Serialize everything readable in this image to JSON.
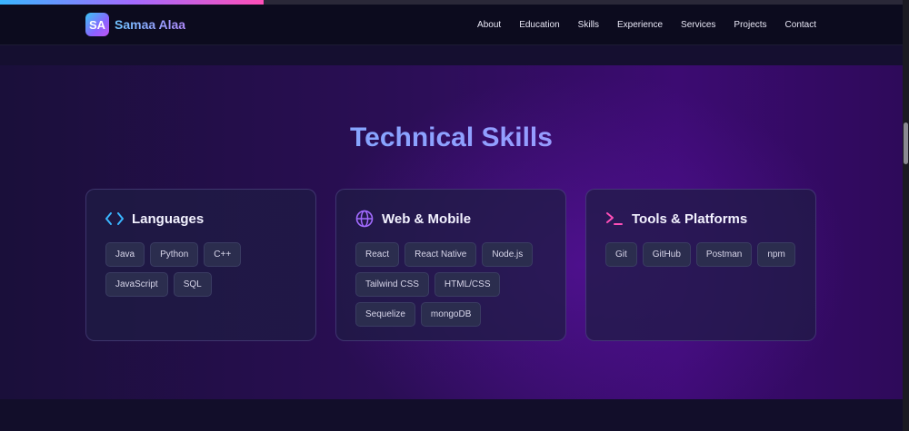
{
  "progress": {
    "fraction": 0.29
  },
  "brand": {
    "logo_text": "SA",
    "name": "Samaa Alaa"
  },
  "nav": {
    "links": [
      "About",
      "Education",
      "Skills",
      "Experience",
      "Services",
      "Projects",
      "Contact"
    ]
  },
  "section": {
    "title": "Technical Skills"
  },
  "cards": [
    {
      "icon": "code-icon",
      "title": "Languages",
      "tags": [
        "Java",
        "Python",
        "C++",
        "JavaScript",
        "SQL"
      ]
    },
    {
      "icon": "globe-icon",
      "title": "Web & Mobile",
      "tags": [
        "React",
        "React Native",
        "Node.js",
        "Tailwind CSS",
        "HTML/CSS",
        "Sequelize",
        "mongoDB"
      ]
    },
    {
      "icon": "terminal-icon",
      "title": "Tools & Platforms",
      "tags": [
        "Git",
        "GitHub",
        "Postman",
        "npm"
      ]
    }
  ],
  "colors": {
    "code_icon": "#3ab6ff",
    "globe_icon": "#a26bff",
    "terminal_icon": "#ff4fb8"
  }
}
